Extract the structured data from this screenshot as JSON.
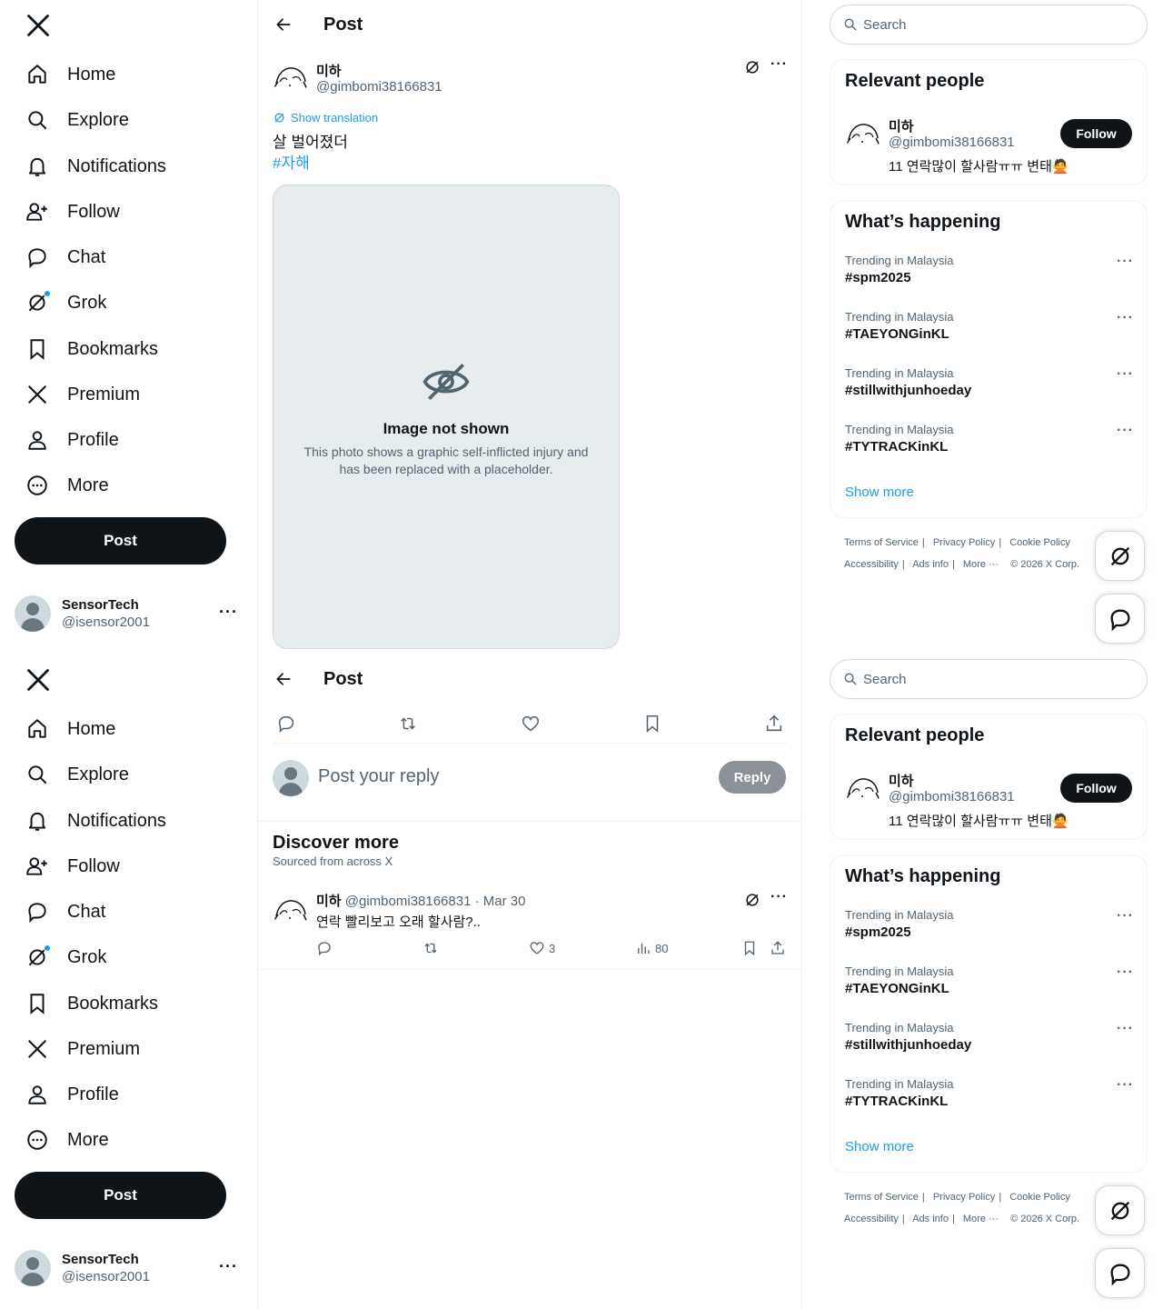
{
  "nav": {
    "items": [
      {
        "label": "Home",
        "icon": "home-icon"
      },
      {
        "label": "Explore",
        "icon": "search-icon"
      },
      {
        "label": "Notifications",
        "icon": "bell-icon"
      },
      {
        "label": "Follow",
        "icon": "person-add-icon"
      },
      {
        "label": "Chat",
        "icon": "chat-bubble-icon"
      },
      {
        "label": "Grok",
        "icon": "grok-icon"
      },
      {
        "label": "Bookmarks",
        "icon": "bookmark-icon"
      },
      {
        "label": "Premium",
        "icon": "x-logo-icon"
      },
      {
        "label": "Profile",
        "icon": "person-icon"
      },
      {
        "label": "More",
        "icon": "more-circle-icon"
      }
    ],
    "post_label": "Post"
  },
  "account": {
    "display_name": "SensorTech",
    "handle": "@isensor2001"
  },
  "header": {
    "title": "Post"
  },
  "post": {
    "author_name": "미하",
    "author_handle": "@gimbomi38166831",
    "show_translation": "Show translation",
    "text": "살 벌어졌더",
    "hashtag": "#자해",
    "media_placeholder_title": "Image not shown",
    "media_placeholder_note": "This photo shows a graphic self-inflicted injury and has been replaced with a placeholder."
  },
  "reply": {
    "placeholder": "Post your reply",
    "button": "Reply"
  },
  "discover": {
    "title": "Discover more",
    "subtitle": "Sourced from across X",
    "post": {
      "author_name": "미하",
      "meta": "@gimbomi38166831 · Mar 30",
      "text": "연락 빨리보고 오래 할사람?..",
      "likes": "3",
      "views": "80"
    }
  },
  "search": {
    "placeholder": "Search"
  },
  "relevant": {
    "title": "Relevant people",
    "name": "미하",
    "handle": "@gimbomi38166831",
    "bio": "11 연락많이 할사람ㅠㅠ 변태🙅",
    "follow": "Follow"
  },
  "happening": {
    "title": "What’s happening",
    "trends": [
      {
        "context": "Trending in Malaysia",
        "name": "#spm2025"
      },
      {
        "context": "Trending in Malaysia",
        "name": "#TAEYONGinKL"
      },
      {
        "context": "Trending in Malaysia",
        "name": "#stillwithjunhoeday"
      },
      {
        "context": "Trending in Malaysia",
        "name": "#TYTRACKinKL"
      }
    ],
    "show_more": "Show more"
  },
  "footer": {
    "terms": "Terms of Service",
    "privacy": "Privacy Policy",
    "cookie": "Cookie Policy",
    "accessibility": "Accessibility",
    "ads": "Ads info",
    "more": "More ···",
    "copyright": "© 2026 X Corp."
  },
  "colors": {
    "accent": "#1d9bf0",
    "text": "#0f1419",
    "muted": "#536471"
  }
}
